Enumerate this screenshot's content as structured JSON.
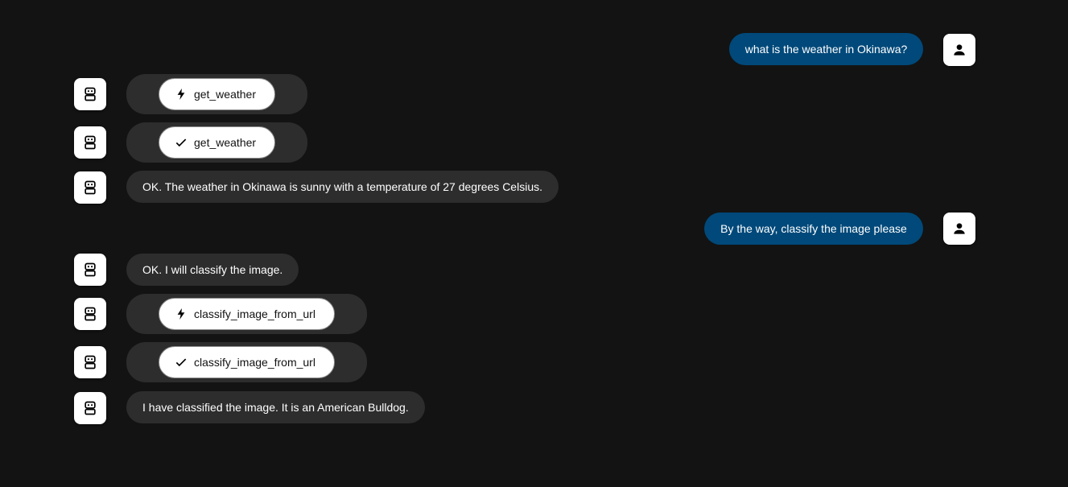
{
  "messages": [
    {
      "role": "user",
      "text": "what is the weather in Okinawa?"
    },
    {
      "role": "assistant",
      "type": "tool_call",
      "icon": "bolt-icon",
      "label": "get_weather"
    },
    {
      "role": "assistant",
      "type": "tool_result",
      "icon": "check-icon",
      "label": "get_weather"
    },
    {
      "role": "assistant",
      "text": "OK. The weather in Okinawa is sunny with a temperature of 27 degrees Celsius."
    },
    {
      "role": "user",
      "text": "By the way, classify the image please"
    },
    {
      "role": "assistant",
      "text": "OK. I will classify the image."
    },
    {
      "role": "assistant",
      "type": "tool_call",
      "icon": "bolt-icon",
      "label": "classify_image_from_url"
    },
    {
      "role": "assistant",
      "type": "tool_result",
      "icon": "check-icon",
      "label": "classify_image_from_url"
    },
    {
      "role": "assistant",
      "text": "I have classified the image. It is an American Bulldog."
    }
  ],
  "colors": {
    "background": "#131313",
    "assistant_bubble": "#2d2d2d",
    "user_bubble": "#00497a",
    "chip": "#ffffff"
  }
}
